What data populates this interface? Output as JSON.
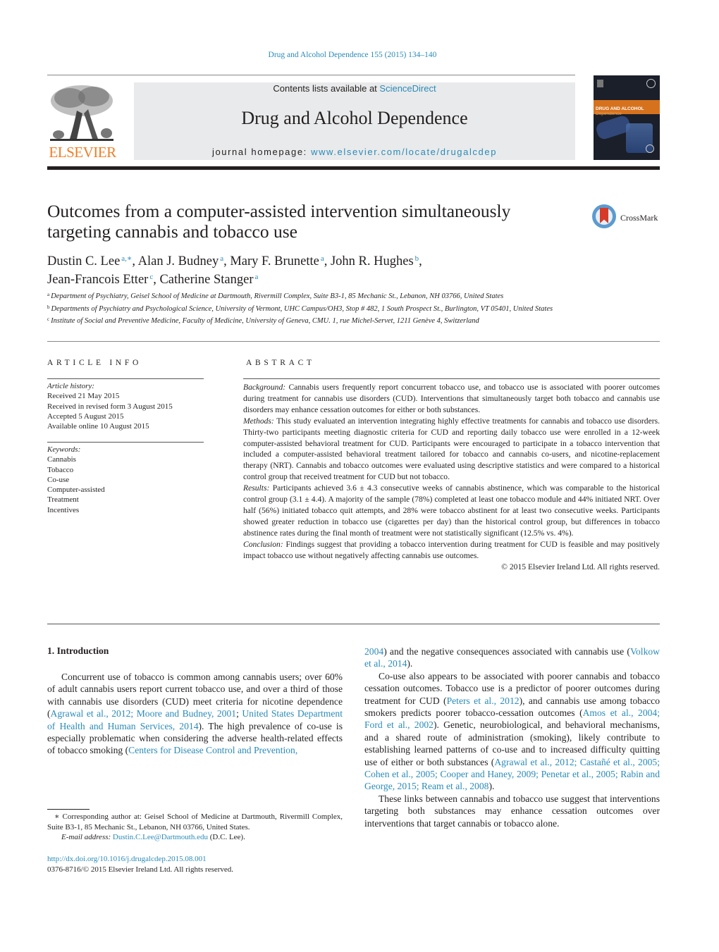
{
  "header": {
    "citation": "Drug and Alcohol Dependence 155 (2015) 134–140",
    "contents_prefix": "Contents lists available at ",
    "contents_link": "ScienceDirect",
    "journal_title": "Drug and Alcohol Dependence",
    "homepage_prefix": "journal homepage: ",
    "homepage_link": "www.elsevier.com/locate/drugalcdep",
    "publisher_logo_text": "ELSEVIER",
    "cover": {
      "line1": "DRUG AND ALCOHOL",
      "line2": "Dependence"
    },
    "brand_color": "#f07e26",
    "link_color": "#2a8bb8"
  },
  "article": {
    "title": "Outcomes from a computer-assisted intervention simultaneously targeting cannabis and tobacco use",
    "crossmark_label": "CrossMark",
    "authors": [
      {
        "name": "Dustin C. Lee",
        "sup": "a,∗",
        "sep": ", "
      },
      {
        "name": "Alan J. Budney",
        "sup": "a",
        "sep": ", "
      },
      {
        "name": "Mary F. Brunette",
        "sup": "a",
        "sep": ", "
      },
      {
        "name": "John R. Hughes",
        "sup": "b",
        "sep": ","
      },
      {
        "name": "Jean-Francois Etter",
        "sup": "c",
        "sep": ", "
      },
      {
        "name": "Catherine Stanger",
        "sup": "a",
        "sep": ""
      }
    ],
    "affiliations": [
      {
        "mark": "a",
        "text": "Department of Psychiatry, Geisel School of Medicine at Dartmouth, Rivermill Complex, Suite B3-1, 85 Mechanic St., Lebanon, NH 03766, United States"
      },
      {
        "mark": "b",
        "text": "Departments of Psychiatry and Psychological Science, University of Vermont, UHC Campus/OH3, Stop # 482, 1 South Prospect St., Burlington, VT 05401, United States"
      },
      {
        "mark": "c",
        "text": "Institute of Social and Preventive Medicine, Faculty of Medicine, University of Geneva, CMU. 1, rue Michel-Servet, 1211 Genève 4, Switzerland"
      }
    ]
  },
  "article_info": {
    "heading": "ARTICLE INFO",
    "history_label": "Article history:",
    "history": [
      "Received 21 May 2015",
      "Received in revised form 3 August 2015",
      "Accepted 5 August 2015",
      "Available online 10 August 2015"
    ],
    "keywords_label": "Keywords:",
    "keywords": [
      "Cannabis",
      "Tobacco",
      "Co-use",
      "Computer-assisted",
      "Treatment",
      "Incentives"
    ]
  },
  "abstract": {
    "heading": "ABSTRACT",
    "sections": [
      {
        "label": "Background:",
        "text": " Cannabis users frequently report concurrent tobacco use, and tobacco use is associated with poorer outcomes during treatment for cannabis use disorders (CUD). Interventions that simultaneously target both tobacco and cannabis use disorders may enhance cessation outcomes for either or both substances."
      },
      {
        "label": "Methods:",
        "text": " This study evaluated an intervention integrating highly effective treatments for cannabis and tobacco use disorders. Thirty-two participants meeting diagnostic criteria for CUD and reporting daily tobacco use were enrolled in a 12-week computer-assisted behavioral treatment for CUD. Participants were encouraged to participate in a tobacco intervention that included a computer-assisted behavioral treatment tailored for tobacco and cannabis co-users, and nicotine-replacement therapy (NRT). Cannabis and tobacco outcomes were evaluated using descriptive statistics and were compared to a historical control group that received treatment for CUD but not tobacco."
      },
      {
        "label": "Results:",
        "text": " Participants achieved 3.6 ± 4.3 consecutive weeks of cannabis abstinence, which was comparable to the historical control group (3.1 ± 4.4). A majority of the sample (78%) completed at least one tobacco module and 44% initiated NRT. Over half (56%) initiated tobacco quit attempts, and 28% were tobacco abstinent for at least two consecutive weeks. Participants showed greater reduction in tobacco use (cigarettes per day) than the historical control group, but differences in tobacco abstinence rates during the final month of treatment were not statistically significant (12.5% vs. 4%)."
      },
      {
        "label": "Conclusion:",
        "text": " Findings suggest that providing a tobacco intervention during treatment for CUD is feasible and may positively impact tobacco use without negatively affecting cannabis use outcomes."
      }
    ],
    "copyright": "© 2015 Elsevier Ireland Ltd. All rights reserved."
  },
  "body": {
    "section_heading": "1.  Introduction",
    "left_paragraph": [
      {
        "t": "Concurrent use of tobacco is common among cannabis users; over 60% of adult cannabis users report current tobacco use, and over a third of those with cannabis use disorders (CUD) meet criteria for nicotine dependence ("
      },
      {
        "link": "Agrawal et al., 2012; Moore and Budney, 2001"
      },
      {
        "t": "; "
      },
      {
        "link": "United States Department of Health and Human Services, 2014"
      },
      {
        "t": "). The high prevalence of co-use is especially problematic when considering the adverse health-related effects of tobacco smoking ("
      },
      {
        "link": "Centers for Disease Control and Prevention,"
      }
    ],
    "right_paragraphs": [
      [
        {
          "link": "2004"
        },
        {
          "t": ") and the negative consequences associated with cannabis use ("
        },
        {
          "link": "Volkow et al., 2014"
        },
        {
          "t": ")."
        }
      ],
      [
        {
          "t": "Co-use also appears to be associated with poorer cannabis and tobacco cessation outcomes. Tobacco use is a predictor of poorer outcomes during treatment for CUD ("
        },
        {
          "link": "Peters et al., 2012"
        },
        {
          "t": "), and cannabis use among tobacco smokers predicts poorer tobacco-cessation outcomes ("
        },
        {
          "link": "Amos et al., 2004; Ford et al., 2002"
        },
        {
          "t": "). Genetic, neurobiological, and behavioral mechanisms, and a shared route of administration (smoking), likely contribute to establishing learned patterns of co-use and to increased difficulty quitting use of either or both substances ("
        },
        {
          "link": "Agrawal et al., 2012; Castañé et al., 2005; Cohen et al., 2005; Cooper and Haney, 2009; Penetar et al., 2005; Rabin and George, 2015; Ream et al., 2008"
        },
        {
          "t": ")."
        }
      ],
      [
        {
          "t": "These links between cannabis and tobacco use suggest that interventions targeting both substances may enhance cessation outcomes over interventions that target cannabis or tobacco alone."
        }
      ]
    ]
  },
  "footnote": {
    "corresponding": "∗ Corresponding author at: Geisel School of Medicine at Dartmouth, Rivermill Complex, Suite B3-1, 85 Mechanic St., Lebanon, NH 03766, United States.",
    "email_label": "E-mail address:",
    "email": "Dustin.C.Lee@Dartmouth.edu",
    "email_suffix": " (D.C. Lee).",
    "doi": "http://dx.doi.org/10.1016/j.drugalcdep.2015.08.001",
    "issn": "0376-8716/© 2015 Elsevier Ireland Ltd. All rights reserved."
  }
}
